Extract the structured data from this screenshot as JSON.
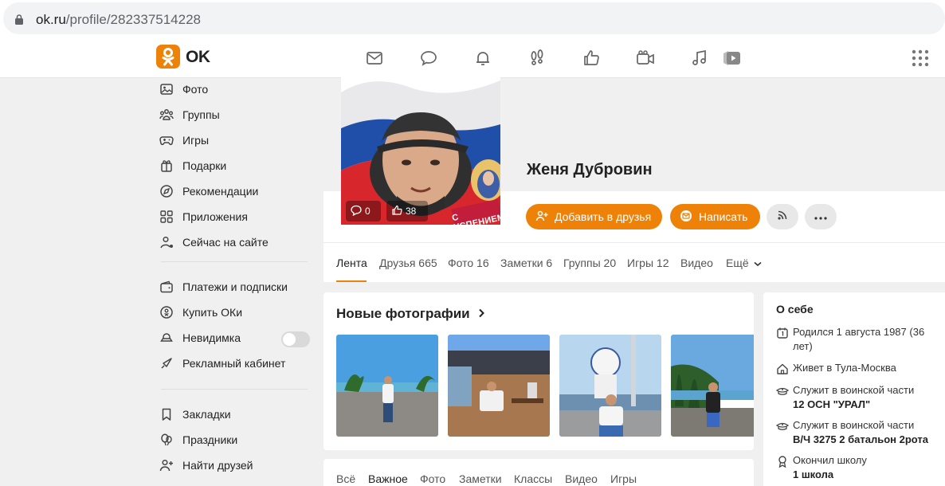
{
  "browser": {
    "url_host": "ok.ru",
    "url_path": "/profile/282337514228"
  },
  "topnav": {
    "logo_text": "OK",
    "icons": [
      "messages-icon",
      "discussions-icon",
      "notifications-icon",
      "guests-icon",
      "likes-icon",
      "video-calls-icon",
      "music-icon",
      "video-icon",
      "apps-grid-icon"
    ]
  },
  "sidebar": {
    "items": [
      {
        "label": "Фото",
        "icon": "photo-icon"
      },
      {
        "label": "Группы",
        "icon": "groups-icon"
      },
      {
        "label": "Игры",
        "icon": "games-icon"
      },
      {
        "label": "Подарки",
        "icon": "gift-icon"
      },
      {
        "label": "Рекомендации",
        "icon": "compass-icon"
      },
      {
        "label": "Приложения",
        "icon": "apps-icon"
      },
      {
        "label": "Сейчас на сайте",
        "icon": "online-users-icon"
      },
      {
        "label": "Платежи и подписки",
        "icon": "wallet-icon"
      },
      {
        "label": "Купить ОКи",
        "icon": "oki-coin-icon"
      },
      {
        "label": "Невидимка",
        "icon": "invisible-icon"
      },
      {
        "label": "Рекламный кабинет",
        "icon": "ads-icon"
      },
      {
        "label": "Закладки",
        "icon": "bookmark-icon"
      },
      {
        "label": "Праздники",
        "icon": "balloons-icon"
      },
      {
        "label": "Найти друзей",
        "icon": "add-friend-icon"
      }
    ],
    "invisible_toggle_on": false
  },
  "profile": {
    "name": "Женя Дубровин",
    "avatar_comments": "0",
    "avatar_likes": "38",
    "avatar_caption": "С УСПЕНИЕМ!",
    "add_friend_label": "Добавить в друзья",
    "write_label": "Написать",
    "tabs": [
      "Лента",
      "Друзья 665",
      "Фото 16",
      "Заметки 6",
      "Группы 20",
      "Игры 12",
      "Видео",
      "Ещё"
    ]
  },
  "photos": {
    "title": "Новые фотографии"
  },
  "about": {
    "title": "О себе",
    "born": "Родился 1 августа 1987 (36 лет)",
    "lives": "Живет в Тула-Москва",
    "military1_label": "Служит в воинской части",
    "military1_value": "12 ОСН \"УРАЛ\"",
    "military2_label": "Служит в воинской части",
    "military2_value": "В/Ч 3275 2 батальон 2рота",
    "school_label": "Окончил школу",
    "school_value": "1 школа"
  },
  "feed": {
    "filters": [
      "Всё",
      "Важное",
      "Фото",
      "Заметки",
      "Классы",
      "Видео",
      "Игры"
    ]
  },
  "colors": {
    "accent": "#ee8208",
    "background": "#f0f0f0"
  }
}
